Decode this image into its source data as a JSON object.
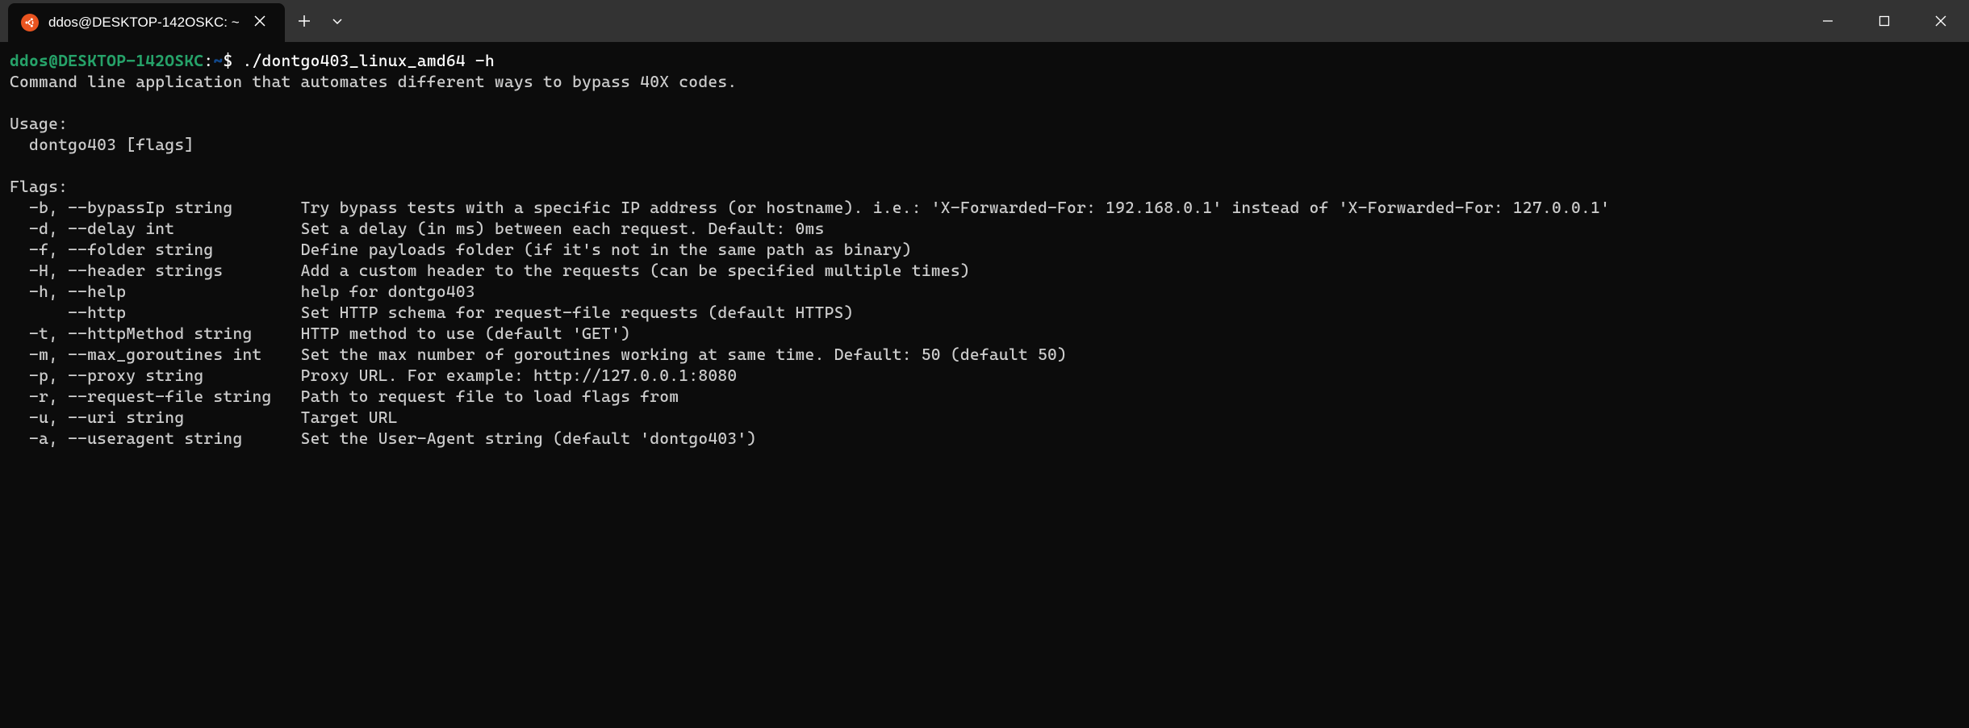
{
  "tab": {
    "title": "ddos@DESKTOP-142OSKC: ~"
  },
  "prompt": {
    "user": "ddos@DESKTOP-142OSKC",
    "path": "~",
    "command": "./dontgo403_linux_amd64 -h"
  },
  "output": {
    "description": "Command line application that automates different ways to bypass 40X codes.",
    "usage_label": "Usage:",
    "usage_line": "  dontgo403 [flags]",
    "flags_label": "Flags:",
    "flags": [
      "  -b, --bypassIp string       Try bypass tests with a specific IP address (or hostname). i.e.: 'X-Forwarded-For: 192.168.0.1' instead of 'X-Forwarded-For: 127.0.0.1'",
      "  -d, --delay int             Set a delay (in ms) between each request. Default: 0ms",
      "  -f, --folder string         Define payloads folder (if it's not in the same path as binary)",
      "  -H, --header strings        Add a custom header to the requests (can be specified multiple times)",
      "  -h, --help                  help for dontgo403",
      "      --http                  Set HTTP schema for request-file requests (default HTTPS)",
      "  -t, --httpMethod string     HTTP method to use (default 'GET')",
      "  -m, --max_goroutines int    Set the max number of goroutines working at same time. Default: 50 (default 50)",
      "  -p, --proxy string          Proxy URL. For example: http://127.0.0.1:8080",
      "  -r, --request-file string   Path to request file to load flags from",
      "  -u, --uri string            Target URL",
      "  -a, --useragent string      Set the User-Agent string (default 'dontgo403')"
    ]
  }
}
